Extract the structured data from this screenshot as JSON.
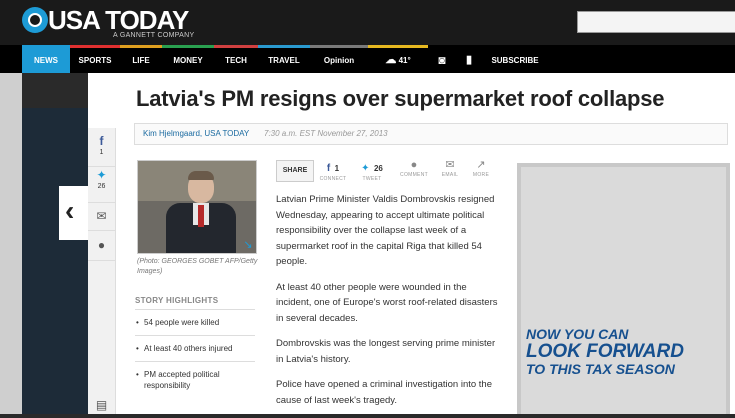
{
  "brand": {
    "name": "USA TODAY",
    "tagline": "A GANNETT COMPANY"
  },
  "search": {
    "placeholder": ""
  },
  "nav": {
    "items": [
      "NEWS",
      "SPORTS",
      "LIFE",
      "MONEY",
      "TECH",
      "TRAVEL",
      "Opinion"
    ],
    "weather": "41°",
    "subscribe": "SUBSCRIBE"
  },
  "social_rail": {
    "facebook_count": "1",
    "twitter_count": "26"
  },
  "article": {
    "headline": "Latvia's PM resigns over supermarket roof collapse",
    "author": "Kim Hjelmgaard, USA TODAY",
    "timestamp": "7:30 a.m. EST November 27, 2013",
    "photo_caption": "(Photo: GEORGES GOBET AFP/Getty Images)",
    "highlights_title": "STORY HIGHLIGHTS",
    "highlights": [
      "54 people were killed",
      "At least 40 others injured",
      "PM accepted political responsibility"
    ],
    "paragraphs": [
      "Latvian Prime Minister Valdis Dombrovskis resigned Wednesday, appearing to accept ultimate political responsibility over the collapse last week of a supermarket roof in the capital Riga that killed 54 people.",
      "At least 40 other people were wounded in the incident, one of Europe's worst roof-related disasters in several decades.",
      "Dombrovskis was the longest serving prime minister in Latvia's history.",
      "Police have opened a criminal investigation into the cause of last week's tragedy."
    ]
  },
  "share": {
    "label": "SHARE",
    "facebook_count": "1",
    "facebook_label": "CONNECT",
    "twitter_count": "26",
    "twitter_label": "TWEET",
    "comment_label": "COMMENT",
    "email_label": "EMAIL",
    "more_label": "MORE"
  },
  "ad": {
    "line1": "NOW YOU CAN",
    "line2": "LOOK FORWARD",
    "line3": "TO THIS TAX SEASON"
  },
  "colors": {
    "accent": "#1d9bd6",
    "nav_bg": "#000000",
    "ad_text": "#16508f"
  }
}
